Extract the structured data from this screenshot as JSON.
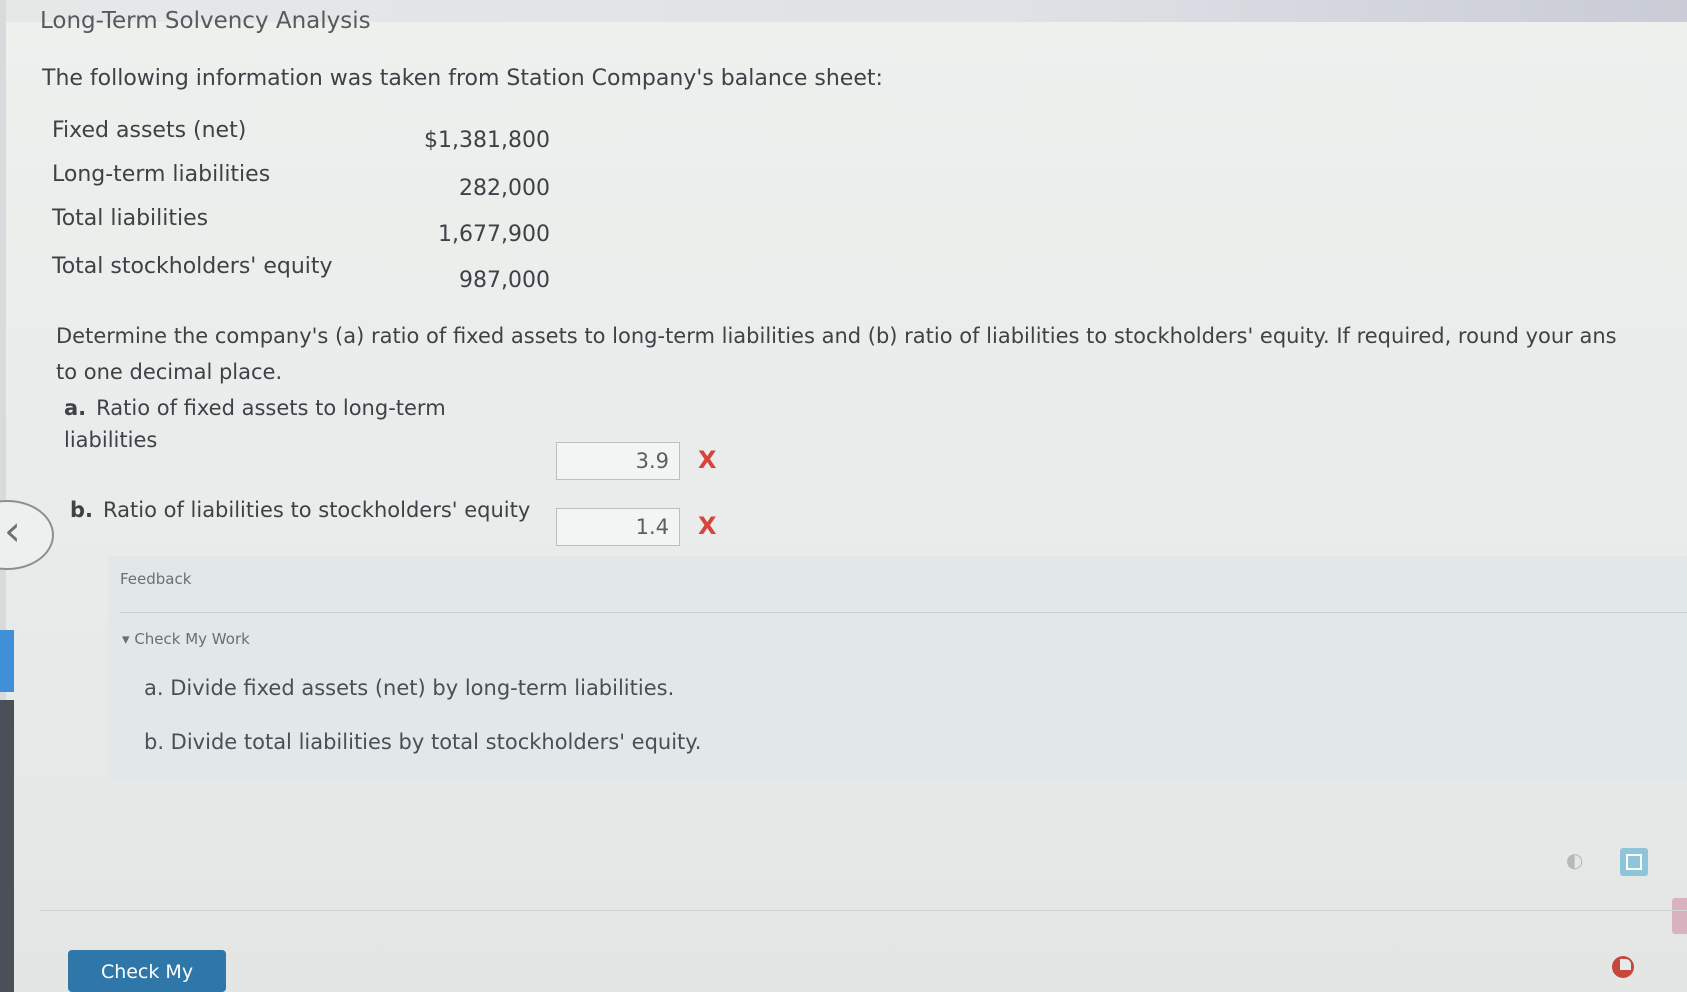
{
  "page": {
    "title": "Long-Term Solvency Analysis",
    "intro": "The following information was taken from Station Company's balance sheet:"
  },
  "balance_sheet": [
    {
      "label": "Fixed assets (net)",
      "value": "$1,381,800"
    },
    {
      "label": "Long-term liabilities",
      "value": "282,000"
    },
    {
      "label": "Total liabilities",
      "value": "1,677,900"
    },
    {
      "label": "Total stockholders' equity",
      "value": "987,000"
    }
  ],
  "instructions": {
    "line1": "Determine the company's (a) ratio of fixed assets to long-term liabilities and (b) ratio of liabilities to stockholders' equity. If required, round your ans",
    "line2": "to one decimal place."
  },
  "questions": [
    {
      "letter": "a.",
      "label_line1": "Ratio of fixed assets to long-term",
      "label_line2": "liabilities",
      "answer": "3.9",
      "status": "X"
    },
    {
      "letter": "b.",
      "label_line1": "Ratio of liabilities to stockholders' equity",
      "label_line2": "",
      "answer": "1.4",
      "status": "X"
    }
  ],
  "feedback": {
    "title": "Feedback",
    "toggle": "Check My Work",
    "hints": [
      "a. Divide fixed assets (net) by long-term liabilities.",
      "b. Divide total liabilities by total stockholders' equity."
    ]
  },
  "footer": {
    "check_button": "Check My Work"
  },
  "colors": {
    "accent": "#2f77a8",
    "error": "#d6443c",
    "feedback_bg": "#e2e8ea"
  },
  "icons": [
    "chevron-left-icon",
    "audio-icon",
    "calculator-icon",
    "progress-icon",
    "triangle-down-icon"
  ]
}
